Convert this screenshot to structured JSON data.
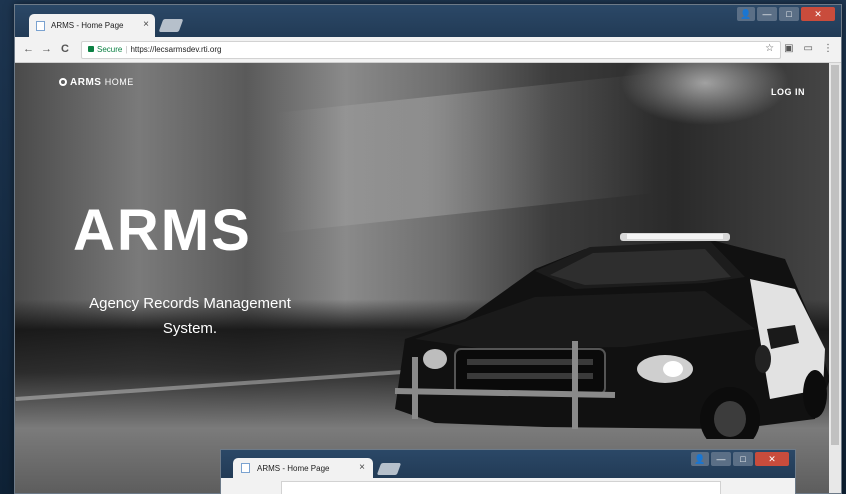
{
  "browser": {
    "tab_title": "ARMS - Home Page",
    "tab_close": "×",
    "address": {
      "secure_label": "Secure",
      "url": "https://lecsarmsdev.rti.org"
    },
    "nav": {
      "back": "←",
      "forward": "→",
      "reload": "C"
    },
    "toolbar_icons": {
      "star": "☆",
      "extension": "▣",
      "cast": "▭",
      "menu": "⋮"
    },
    "window_controls": {
      "user": "👤",
      "minimize": "—",
      "maximize": "□",
      "close": "✕"
    }
  },
  "page": {
    "brand": {
      "name": "ARMS",
      "suffix": "HOME"
    },
    "login_label": "LOG IN",
    "hero_title": "ARMS",
    "hero_subtitle_line1": "Agency Records Management",
    "hero_subtitle_line2": "System."
  },
  "background_window": {
    "tab_title": "ARMS - Home Page",
    "tab_close": "×"
  },
  "colors": {
    "desktop": "#1d3550",
    "chrome_frame": "#2b4867",
    "secure_green": "#0b8043",
    "close_red": "#c94c3c"
  }
}
